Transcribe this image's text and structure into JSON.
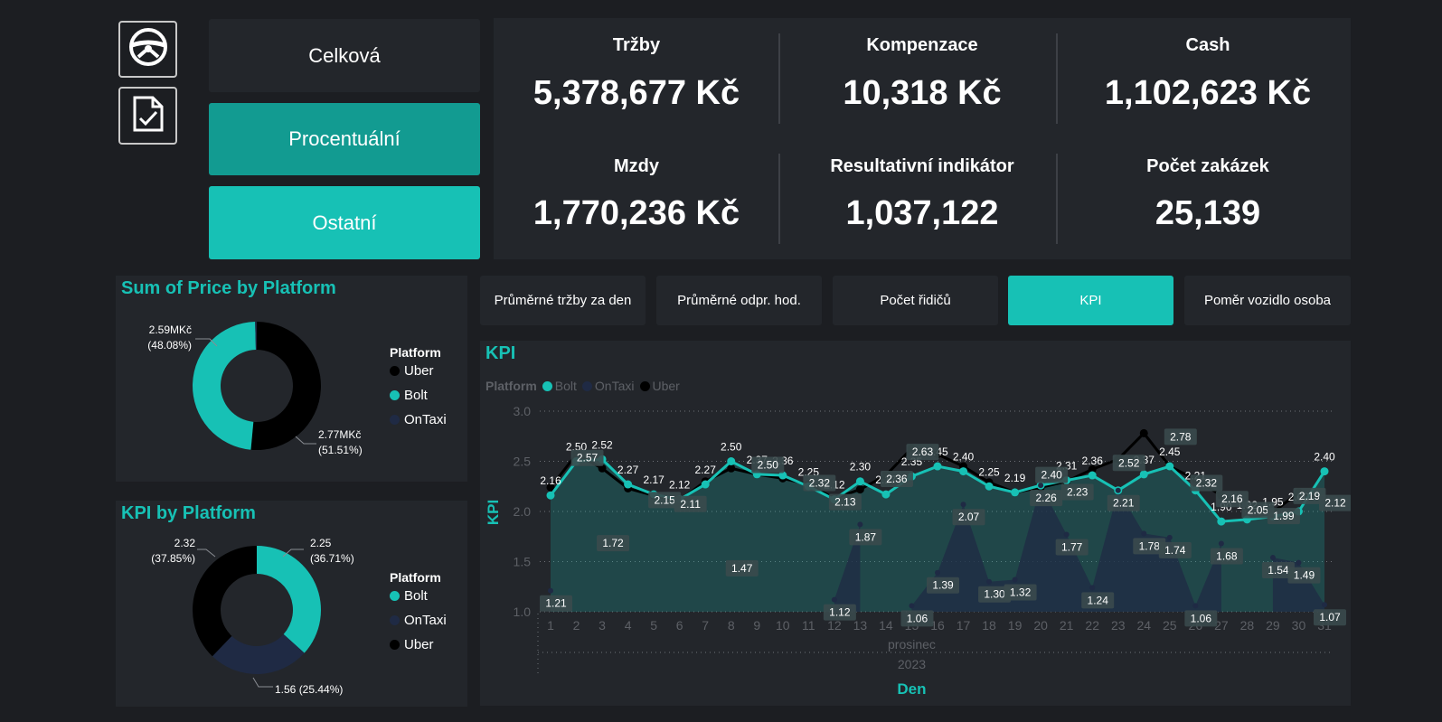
{
  "nav": {
    "steering_icon": "steering-wheel-icon",
    "doc_icon": "document-check-icon",
    "buttons": [
      "Celková",
      "Procentuální",
      "Ostatní"
    ]
  },
  "kpis": {
    "trzby_label": "Tržby",
    "trzby_value": "5,378,677 Kč",
    "kompenzace_label": "Kompenzace",
    "kompenzace_value": "10,318 Kč",
    "cash_label": "Cash",
    "cash_value": "1,102,623 Kč",
    "mzdy_label": "Mzdy",
    "mzdy_value": "1,770,236 Kč",
    "indikator_label": "Resultativní indikátor",
    "indikator_value": "1,037,122",
    "zakazky_label": "Počet zakázek",
    "zakazky_value": "25,139"
  },
  "tabs": [
    "Průměrné tržby za den",
    "Průměrné odpr. hod.",
    "Počet řidičů",
    "KPI",
    "Poměr vozidlo osoba"
  ],
  "colors": {
    "bolt": "#17c1b5",
    "uber": "#000000",
    "ontaxi": "#1f2a44",
    "panel": "#23262b",
    "accent": "#17c1b5"
  },
  "chart_data": [
    {
      "type": "donut",
      "title": "Sum of Price by Platform",
      "legend_title": "Platform",
      "legend": [
        "Uber",
        "Bolt",
        "OnTaxi"
      ],
      "slices": [
        {
          "name": "Uber",
          "value": 2.77,
          "label": "2.77MKč",
          "pct": "(51.51%)"
        },
        {
          "name": "Bolt",
          "value": 2.59,
          "label": "2.59MKč",
          "pct": "(48.08%)"
        },
        {
          "name": "OnTaxi",
          "value": 0.022,
          "label": "",
          "pct": ""
        }
      ]
    },
    {
      "type": "donut",
      "title": "KPI by Platform",
      "legend_title": "Platform",
      "legend": [
        "Bolt",
        "OnTaxi",
        "Uber"
      ],
      "slices": [
        {
          "name": "Bolt",
          "value": 2.25,
          "label": "2.25",
          "pct": "(36.71%)"
        },
        {
          "name": "OnTaxi",
          "value": 1.56,
          "label": "1.56 (25.44%)",
          "pct": ""
        },
        {
          "name": "Uber",
          "value": 2.32,
          "label": "2.32",
          "pct": "(37.85%)"
        }
      ]
    },
    {
      "type": "line",
      "title": "KPI",
      "legend_title": "Platform",
      "legend": [
        "Bolt",
        "OnTaxi",
        "Uber"
      ],
      "xlabel": "Den",
      "ylabel": "KPI",
      "x_month": "prosinec",
      "x_year": "2023",
      "ylim": [
        1.0,
        3.0
      ],
      "yticks": [
        "1.0",
        "1.5",
        "2.0",
        "2.5",
        "3.0"
      ],
      "x": [
        1,
        2,
        3,
        4,
        5,
        6,
        7,
        8,
        9,
        10,
        11,
        12,
        13,
        14,
        15,
        16,
        17,
        18,
        19,
        20,
        21,
        22,
        23,
        24,
        25,
        26,
        27,
        28,
        29,
        30,
        31
      ],
      "series": [
        {
          "name": "OnTaxi",
          "values": [
            1.21,
            null,
            null,
            null,
            null,
            null,
            null,
            null,
            null,
            null,
            null,
            1.12,
            1.87,
            null,
            1.06,
            1.39,
            2.07,
            1.3,
            1.32,
            2.26,
            1.77,
            1.24,
            2.21,
            1.78,
            1.74,
            1.06,
            1.68,
            null,
            1.54,
            1.49,
            1.07
          ],
          "labels": [
            "1.21",
            "",
            "",
            "",
            "",
            "",
            "",
            "",
            "",
            "",
            "",
            "1.12",
            "1.87",
            "",
            "1.06",
            "1.39",
            "2.07",
            "1.30",
            "1.32",
            "2.26",
            "1.77",
            "1.24",
            "2.21",
            "1.78",
            "1.74",
            "1.06",
            "1.68",
            "",
            "1.54",
            "1.49",
            "1.07"
          ]
        },
        {
          "name": "Bolt",
          "values": [
            2.16,
            2.5,
            2.52,
            2.27,
            2.17,
            2.12,
            2.27,
            2.5,
            2.37,
            2.36,
            2.25,
            2.12,
            2.3,
            2.17,
            2.35,
            2.45,
            2.4,
            2.25,
            2.19,
            2.26,
            2.31,
            2.36,
            2.21,
            2.37,
            2.45,
            2.21,
            1.9,
            1.92,
            1.95,
            2.0,
            2.4
          ],
          "labels": [
            "2.16",
            "2.50",
            "2.52",
            "2.27",
            "2.17",
            "2.12",
            "2.27",
            "2.50",
            "2.37",
            "2.36",
            "2.25",
            "2.12",
            "2.30",
            "2.17",
            "2.35",
            "2.45",
            "2.40",
            "2.25",
            "2.19",
            "",
            "2.31",
            "2.36",
            "",
            "2.37",
            "2.45",
            "2.21",
            "1.90",
            "1.92",
            "1.95",
            "2.00",
            "2.40"
          ]
        },
        {
          "name": "Uber",
          "values": [
            2.24,
            2.57,
            2.43,
            2.23,
            2.16,
            2.11,
            2.3,
            2.43,
            2.37,
            2.33,
            2.27,
            2.13,
            2.22,
            2.36,
            2.63,
            2.57,
            2.45,
            2.29,
            2.19,
            2.24,
            2.3,
            2.42,
            2.52,
            2.78,
            2.45,
            2.32,
            2.16,
            2.05,
            1.99,
            2.19,
            2.12
          ],
          "labels": [
            "",
            "2.57",
            "1.72",
            "",
            "2.15",
            "2.11",
            "",
            "1.47",
            "2.50",
            "",
            "2.32",
            "2.13",
            "",
            "2.36",
            "2.63",
            "",
            "",
            "",
            "",
            "2.40",
            "2.23",
            "",
            "2.52",
            "",
            "2.78",
            "2.32",
            "2.16",
            "2.05",
            "1.99",
            "2.19",
            "2.12"
          ]
        }
      ]
    }
  ]
}
